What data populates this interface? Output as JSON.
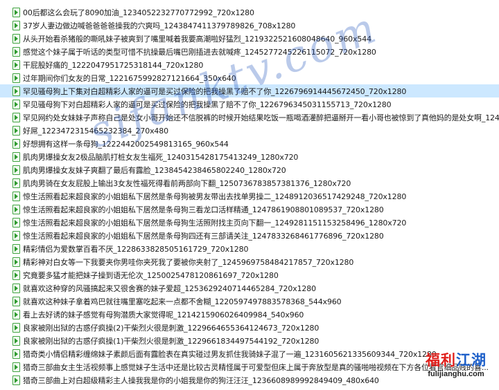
{
  "files": [
    {
      "name": "00后都这么会玩了8090加油_1234052232770772992_720x1280"
    },
    {
      "name": "37岁人妻边做边喊爸爸爸爸操我的穴爽吗_1243847411379789826_708x1280"
    },
    {
      "name": "从头开始看杀猪般的嘶吼妹子被爽到了嘴里喊着我要高潮啦好猛烈_1219322521608048640_960x544"
    },
    {
      "name": "感觉这个妹子属于听话的类型可惜不抗操最后嘴巴刚插进去就喊疼_1245277245226115072_720x1280"
    },
    {
      "name": "干屁股好痛的_1222047951725318144_720x1280"
    },
    {
      "name": "过年期间你们女友的日常_1221675992827121664_350x640"
    },
    {
      "name": "罕见骚母狗上下集对白超精彩人家的逼可是买过保险的把我操黑了赔不了你_1226796914445672450_720x1280",
      "state": "selected"
    },
    {
      "name": "罕见骚母狗下对白超精彩人家的逼可是买过保险的把我操黑了赔不了你_1226796345031155713_720x1280"
    },
    {
      "name": "罕见网约处女妹妹子声称自己是处女小哥开始还不信脱裤的时候开始结果吃饭一瓶喝酒灌醉把逼掰开一看小哥也被惊到了真他妈的是处女啊_124..."
    },
    {
      "name": "好屌_1223472315465232384_270x480"
    },
    {
      "name": "好想拥有这样一条母狗_1222442002549813165_960x544"
    },
    {
      "name": "肌肉男爆操女友2极品脑肌打桩女友生福死_1240315428175413249_1280x720"
    },
    {
      "name": "肌肉男爆操女友妹子爽翻了最后有露脸_1238454238465802240_1280x720"
    },
    {
      "name": "肌肉男骑在女友屁股上输出3女友性福死得看前两部向下翻_1250736783857381376_1280x720"
    },
    {
      "name": "惊生活照看起来超良家的小姐姐私下居然是条母狗被男友带出去找单男操二_1248912036517429248_720x1280"
    },
    {
      "name": "惊生活照看起来超良家的小姐姐私下居然是条母狗三看龙口活样精通_1247861908801089537_720x1280"
    },
    {
      "name": "惊生活照看起来超良家的小姐姐私下居然是条母狗生活照附找主页向下翻一_1249281151153258496_1280x720"
    },
    {
      "name": "惊生活照看起来超良家的小姐姐私下居然是条母狗四还有三部请关注_1247833268461776896_720x1280"
    },
    {
      "name": "精彩情侣为爱数掌百看不厌_1228633828505161729_720x1280"
    },
    {
      "name": "精彩神对白女等一下我要夹你男哇你夹死我了要被你夹射了_1245969758484217857_720x1280"
    },
    {
      "name": "究竟要多猛才能把妹子操到语无伦次_1250025478120861697_720x1280"
    },
    {
      "name": "就喜欢这种穿的风骚搞起来又很舍赛的妹子爱超_1253629240714465284_720x1280"
    },
    {
      "name": "就喜欢这种妹子拿着鸡巴就往嘴里塞吃起来一点都不舍糊_1220597497883578368_544x960"
    },
    {
      "name": "看上去好诱的妹子感觉有母狗潜质大家觉得呢_1214215906026409984_540x960"
    },
    {
      "name": "良家被刚出狱的古惑仔疯操(2)干柴烈火很是刺激_1229664655364124673_720x1280"
    },
    {
      "name": "良家被刚出狱的古惑仔疯操(1)干柴烈火很是刺激_1229661834497544192_720x1280"
    },
    {
      "name": "猎奇类小情侣精彩缠绵妹子素颜后面有露脸表在真实碰过男友抓住我骑妹子混了一遍_1231605621335609344_720x1280"
    },
    {
      "name": "猎奇三部曲女主生活视频事上感觉妹子生活中还是比较古灵精怪属于可爱型但床上属于奔放型是真的骚啪啪视频在下方各位看官细品贱的喜..."
    },
    {
      "name": "猎奇三部曲上对白超级精彩主人操我我是你的小姐我是你的狗汪汪汪_1236608989992849409_480x640"
    }
  ],
  "watermark_text": "sifanktv.com",
  "logo": {
    "cn_part1": "福利",
    "cn_part2": "江湖",
    "url": "fulijianghu.com"
  },
  "colors": {
    "selected_bg": "#cce8ff",
    "file_icon_green": "#2e9a2e",
    "watermark_blue": "#2a5abe",
    "logo_red": "#e0201c",
    "logo_blue": "#1d5fc9"
  },
  "icons": {
    "file_icon": "video-file-icon"
  }
}
